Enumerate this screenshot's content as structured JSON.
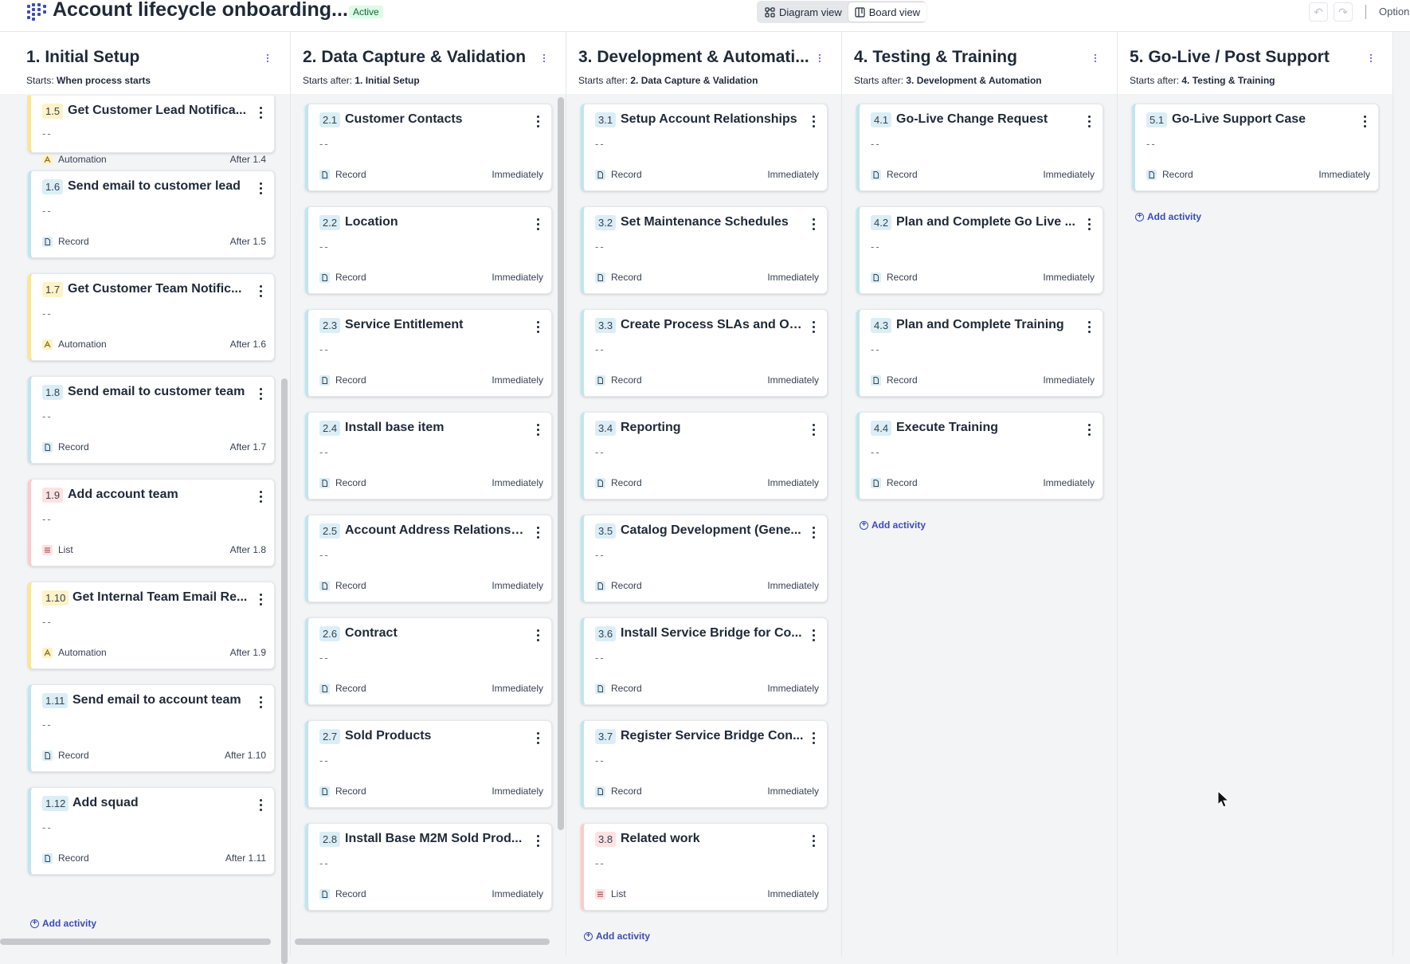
{
  "header": {
    "title": "Account lifecycle onboarding...",
    "status": "Active",
    "views": [
      {
        "label": "Diagram view",
        "active": false
      },
      {
        "label": "Board view",
        "active": true
      }
    ],
    "options_label": "Option"
  },
  "colors": {
    "accent": "#3b4cb8",
    "record": "#bfe6f0",
    "automation": "#fde68a",
    "list": "#fecaca"
  },
  "add_activity_label": "Add activity",
  "columns": [
    {
      "title": "1. Initial Setup",
      "starts_prefix": "Starts:",
      "starts_value": "When process starts",
      "cards": [
        {
          "num": "1.5",
          "title": "Get Customer Lead Notifica...",
          "desc": "--",
          "type": "Automation",
          "icon": "automation-icon",
          "timing": "After 1.4"
        },
        {
          "num": "1.6",
          "title": "Send email to customer lead",
          "desc": "--",
          "type": "Record",
          "icon": "record-icon",
          "timing": "After 1.5"
        },
        {
          "num": "1.7",
          "title": "Get Customer Team Notific...",
          "desc": "--",
          "type": "Automation",
          "icon": "automation-icon",
          "timing": "After 1.6"
        },
        {
          "num": "1.8",
          "title": "Send email to customer team",
          "desc": "--",
          "type": "Record",
          "icon": "record-icon",
          "timing": "After 1.7"
        },
        {
          "num": "1.9",
          "title": "Add account team",
          "desc": "--",
          "type": "List",
          "icon": "list-icon",
          "timing": "After 1.8"
        },
        {
          "num": "1.10",
          "title": "Get Internal Team Email Re...",
          "desc": "--",
          "type": "Automation",
          "icon": "automation-icon",
          "timing": "After 1.9"
        },
        {
          "num": "1.11",
          "title": "Send email to account team",
          "desc": "--",
          "type": "Record",
          "icon": "record-icon",
          "timing": "After 1.10"
        },
        {
          "num": "1.12",
          "title": "Add squad",
          "desc": "--",
          "type": "Record",
          "icon": "record-icon",
          "timing": "After 1.11"
        }
      ]
    },
    {
      "title": "2. Data Capture & Validation",
      "starts_prefix": "Starts after:",
      "starts_value": "1. Initial Setup",
      "cards": [
        {
          "num": "2.1",
          "title": "Customer Contacts",
          "desc": "--",
          "type": "Record",
          "icon": "record-icon",
          "timing": "Immediately"
        },
        {
          "num": "2.2",
          "title": "Location",
          "desc": "--",
          "type": "Record",
          "icon": "record-icon",
          "timing": "Immediately"
        },
        {
          "num": "2.3",
          "title": "Service Entitlement",
          "desc": "--",
          "type": "Record",
          "icon": "record-icon",
          "timing": "Immediately"
        },
        {
          "num": "2.4",
          "title": "Install base item",
          "desc": "--",
          "type": "Record",
          "icon": "record-icon",
          "timing": "Immediately"
        },
        {
          "num": "2.5",
          "title": "Account Address Relationship",
          "desc": "--",
          "type": "Record",
          "icon": "record-icon",
          "timing": "Immediately"
        },
        {
          "num": "2.6",
          "title": "Contract",
          "desc": "--",
          "type": "Record",
          "icon": "record-icon",
          "timing": "Immediately"
        },
        {
          "num": "2.7",
          "title": "Sold Products",
          "desc": "--",
          "type": "Record",
          "icon": "record-icon",
          "timing": "Immediately"
        },
        {
          "num": "2.8",
          "title": "Install Base M2M Sold Prod...",
          "desc": "--",
          "type": "Record",
          "icon": "record-icon",
          "timing": "Immediately"
        }
      ]
    },
    {
      "title": "3. Development & Automati...",
      "starts_prefix": "Starts after:",
      "starts_value": "2. Data Capture & Validation",
      "cards": [
        {
          "num": "3.1",
          "title": "Setup Account Relationships",
          "desc": "--",
          "type": "Record",
          "icon": "record-icon",
          "timing": "Immediately"
        },
        {
          "num": "3.2",
          "title": "Set Maintenance Schedules",
          "desc": "--",
          "type": "Record",
          "icon": "record-icon",
          "timing": "Immediately"
        },
        {
          "num": "3.3",
          "title": "Create Process SLAs and Off...",
          "desc": "--",
          "type": "Record",
          "icon": "record-icon",
          "timing": "Immediately"
        },
        {
          "num": "3.4",
          "title": "Reporting",
          "desc": "--",
          "type": "Record",
          "icon": "record-icon",
          "timing": "Immediately"
        },
        {
          "num": "3.5",
          "title": "Catalog Development (Gene...",
          "desc": "--",
          "type": "Record",
          "icon": "record-icon",
          "timing": "Immediately"
        },
        {
          "num": "3.6",
          "title": "Install Service Bridge for Co...",
          "desc": "--",
          "type": "Record",
          "icon": "record-icon",
          "timing": "Immediately"
        },
        {
          "num": "3.7",
          "title": "Register Service Bridge Con...",
          "desc": "--",
          "type": "Record",
          "icon": "record-icon",
          "timing": "Immediately"
        },
        {
          "num": "3.8",
          "title": "Related work",
          "desc": "--",
          "type": "List",
          "icon": "list-icon",
          "timing": "Immediately"
        }
      ]
    },
    {
      "title": "4. Testing & Training",
      "starts_prefix": "Starts after:",
      "starts_value": "3. Development & Automation",
      "cards": [
        {
          "num": "4.1",
          "title": "Go-Live Change Request",
          "desc": "--",
          "type": "Record",
          "icon": "record-icon",
          "timing": "Immediately"
        },
        {
          "num": "4.2",
          "title": "Plan and Complete Go Live ...",
          "desc": "--",
          "type": "Record",
          "icon": "record-icon",
          "timing": "Immediately"
        },
        {
          "num": "4.3",
          "title": "Plan and Complete Training",
          "desc": "--",
          "type": "Record",
          "icon": "record-icon",
          "timing": "Immediately"
        },
        {
          "num": "4.4",
          "title": "Execute Training",
          "desc": "--",
          "type": "Record",
          "icon": "record-icon",
          "timing": "Immediately"
        }
      ]
    },
    {
      "title": "5. Go-Live / Post Support",
      "starts_prefix": "Starts after:",
      "starts_value": "4. Testing & Training",
      "cards": [
        {
          "num": "5.1",
          "title": "Go-Live Support Case",
          "desc": "--",
          "type": "Record",
          "icon": "record-icon",
          "timing": "Immediately"
        }
      ]
    }
  ]
}
